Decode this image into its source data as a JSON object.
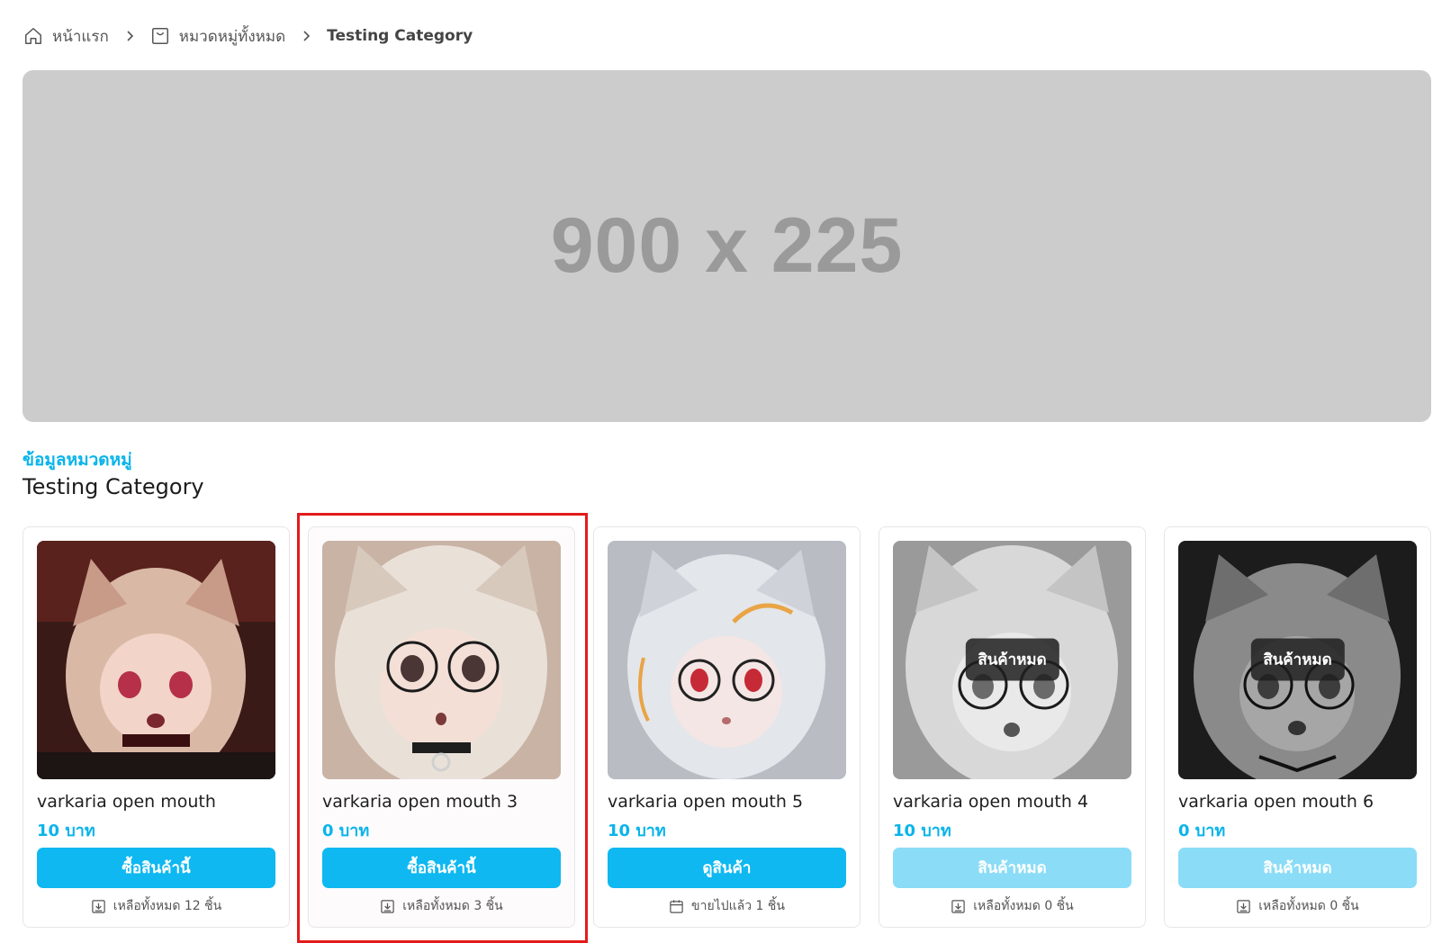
{
  "breadcrumb": {
    "home": "หน้าแรก",
    "all_categories": "หมวดหมู่ทั้งหมด",
    "current": "Testing Category",
    "icons": [
      "home-icon",
      "category-box-icon",
      "chevron-right-icon"
    ]
  },
  "banner": {
    "text": "900 x 225"
  },
  "category": {
    "label": "ข้อมูลหมวดหมู่",
    "title": "Testing Category"
  },
  "colors": {
    "accent": "#0ab4ea",
    "button": "#0fb8f0",
    "button_disabled": "#8bdcf6",
    "highlight": "#e31b1b"
  },
  "products": [
    {
      "name": "varkaria open mouth",
      "price": "10 บาท",
      "button": "ซื้อสินค้านี้",
      "button_disabled": false,
      "stock": "เหลือทั้งหมด 12 ชิ้น",
      "stock_icon": "box-download-icon",
      "sold_out_badge": "",
      "image_style": "color-dark"
    },
    {
      "name": "varkaria open mouth 3",
      "price": "0 บาท",
      "button": "ซื้อสินค้านี้",
      "button_disabled": false,
      "stock": "เหลือทั้งหมด 3 ชิ้น",
      "stock_icon": "box-download-icon",
      "sold_out_badge": "",
      "image_style": "color-light"
    },
    {
      "name": "varkaria open mouth 5",
      "price": "10 บาท",
      "button": "ดูสินค้า",
      "button_disabled": false,
      "stock": "ขายไปแล้ว 1 ชิ้น",
      "stock_icon": "calendar-icon",
      "sold_out_badge": "",
      "image_style": "color-pale"
    },
    {
      "name": "varkaria open mouth 4",
      "price": "10 บาท",
      "button": "สินค้าหมด",
      "button_disabled": true,
      "stock": "เหลือทั้งหมด 0 ชิ้น",
      "stock_icon": "box-download-icon",
      "sold_out_badge": "สินค้าหมด",
      "image_style": "gray-light"
    },
    {
      "name": "varkaria open mouth 6",
      "price": "0 บาท",
      "button": "สินค้าหมด",
      "button_disabled": true,
      "stock": "เหลือทั้งหมด 0 ชิ้น",
      "stock_icon": "box-download-icon",
      "sold_out_badge": "สินค้าหมด",
      "image_style": "gray-dark"
    }
  ]
}
